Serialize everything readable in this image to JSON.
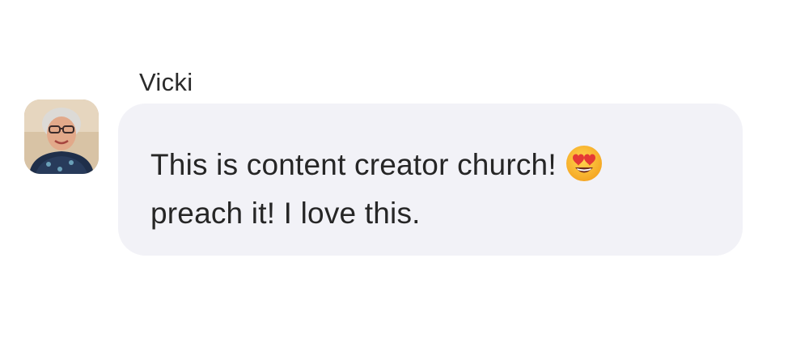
{
  "message": {
    "sender": "Vicki",
    "line1": "This is content creator church!",
    "line2": "preach it! I love this.",
    "emoji": "heart-eyes-emoji",
    "avatar": "avatar"
  },
  "colors": {
    "bubble_bg": "#f2f2f7",
    "text": "#262626"
  }
}
